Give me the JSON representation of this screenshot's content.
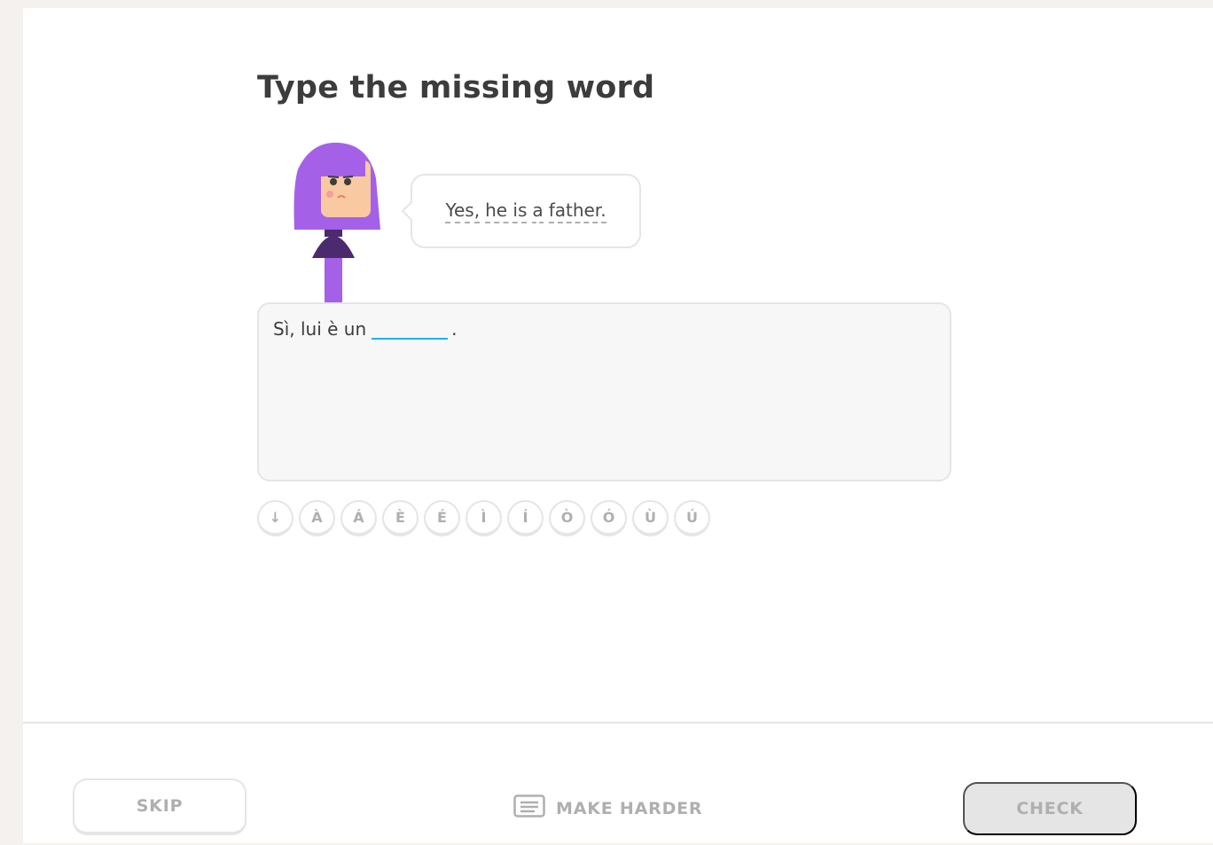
{
  "challenge": {
    "title": "Type the missing word"
  },
  "bubble": {
    "words": [
      "Yes,",
      "he is",
      "a",
      "father."
    ]
  },
  "sentence": {
    "before": "Sì, lui è un",
    "blank_value": "",
    "after": "."
  },
  "keyboard": {
    "keys": [
      "↓",
      "À",
      "Á",
      "È",
      "É",
      "Ì",
      "Í",
      "Ò",
      "Ó",
      "Ù",
      "Ú"
    ]
  },
  "footer": {
    "skip_label": "SKIP",
    "make_harder_label": "MAKE HARDER",
    "check_label": "CHECK"
  },
  "colors": {
    "accent_blue": "#1cb0f6",
    "character_purple": "#a560e8",
    "border_gray": "#e5e5e5"
  },
  "icons": {
    "make_harder": "keyboard-icon"
  }
}
